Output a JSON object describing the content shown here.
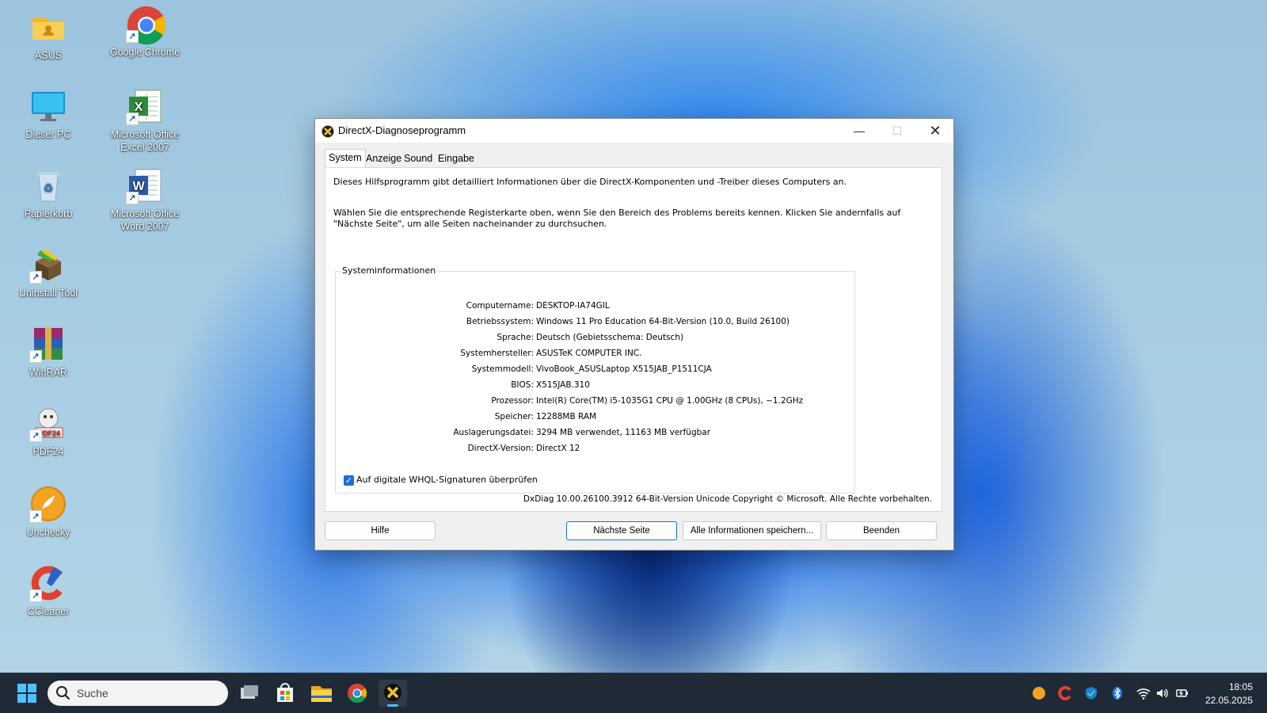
{
  "desktop": {
    "icons": [
      {
        "label_line1": "ASUS",
        "label_line2": ""
      },
      {
        "label_line1": "Google Chrome",
        "label_line2": ""
      },
      {
        "label_line1": "Dieser PC",
        "label_line2": ""
      },
      {
        "label_line1": "Microsoft Office",
        "label_line2": "Excel 2007"
      },
      {
        "label_line1": "Papierkorb",
        "label_line2": ""
      },
      {
        "label_line1": "Microsoft Office",
        "label_line2": "Word 2007"
      },
      {
        "label_line1": "Uninstall Tool",
        "label_line2": ""
      },
      {
        "label_line1": "WinRAR",
        "label_line2": ""
      },
      {
        "label_line1": "PDF24",
        "label_line2": ""
      },
      {
        "label_line1": "Unchecky",
        "label_line2": ""
      },
      {
        "label_line1": "CCleaner",
        "label_line2": ""
      }
    ]
  },
  "window": {
    "title": "DirectX-Diagnoseprogramm",
    "tabs": [
      "System",
      "Anzeige",
      "Sound",
      "Eingabe"
    ],
    "intro1": "Dieses Hilfsprogramm gibt detailliert Informationen über die DirectX-Komponenten und -Treiber dieses Computers an.",
    "intro2_line1": "Wählen Sie die entsprechende Registerkarte oben, wenn Sie den Bereich des Problems bereits kennen. Klicken Sie andernfalls auf",
    "intro2_line2": "\"Nächste Seite\", um alle Seiten nacheinander zu durchsuchen.",
    "group_title": "Systeminformationen",
    "info": [
      {
        "label": "Computername:",
        "value": "DESKTOP-IA74GIL"
      },
      {
        "label": "Betriebssystem:",
        "value": "Windows 11 Pro Education 64-Bit-Version (10.0, Build 26100)"
      },
      {
        "label": "Sprache:",
        "value": "Deutsch (Gebietsschema: Deutsch)"
      },
      {
        "label": "Systemhersteller:",
        "value": "ASUSTeK COMPUTER INC."
      },
      {
        "label": "Systemmodell:",
        "value": "VivoBook_ASUSLaptop X515JAB_P1511CJA"
      },
      {
        "label": "BIOS:",
        "value": "X515JAB.310"
      },
      {
        "label": "Prozessor:",
        "value": "Intel(R) Core(TM) i5-1035G1 CPU @ 1.00GHz (8 CPUs), ~1.2GHz"
      },
      {
        "label": "Speicher:",
        "value": "12288MB RAM"
      },
      {
        "label": "Auslagerungsdatei:",
        "value": "3294 MB verwendet, 11163 MB verfügbar"
      },
      {
        "label": "DirectX-Version:",
        "value": "DirectX 12"
      }
    ],
    "checkbox_label": "Auf digitale WHQL-Signaturen überprüfen",
    "footer": "DxDiag 10.00.26100.3912 64-Bit-Version Unicode Copyright © Microsoft. Alle Rechte vorbehalten.",
    "buttons": {
      "help": "Hilfe",
      "next": "Nächste Seite",
      "save": "Alle Informationen speichern...",
      "exit": "Beenden"
    }
  },
  "taskbar": {
    "search_placeholder": "Suche",
    "time": "18:05",
    "date": "22.05.2025"
  }
}
